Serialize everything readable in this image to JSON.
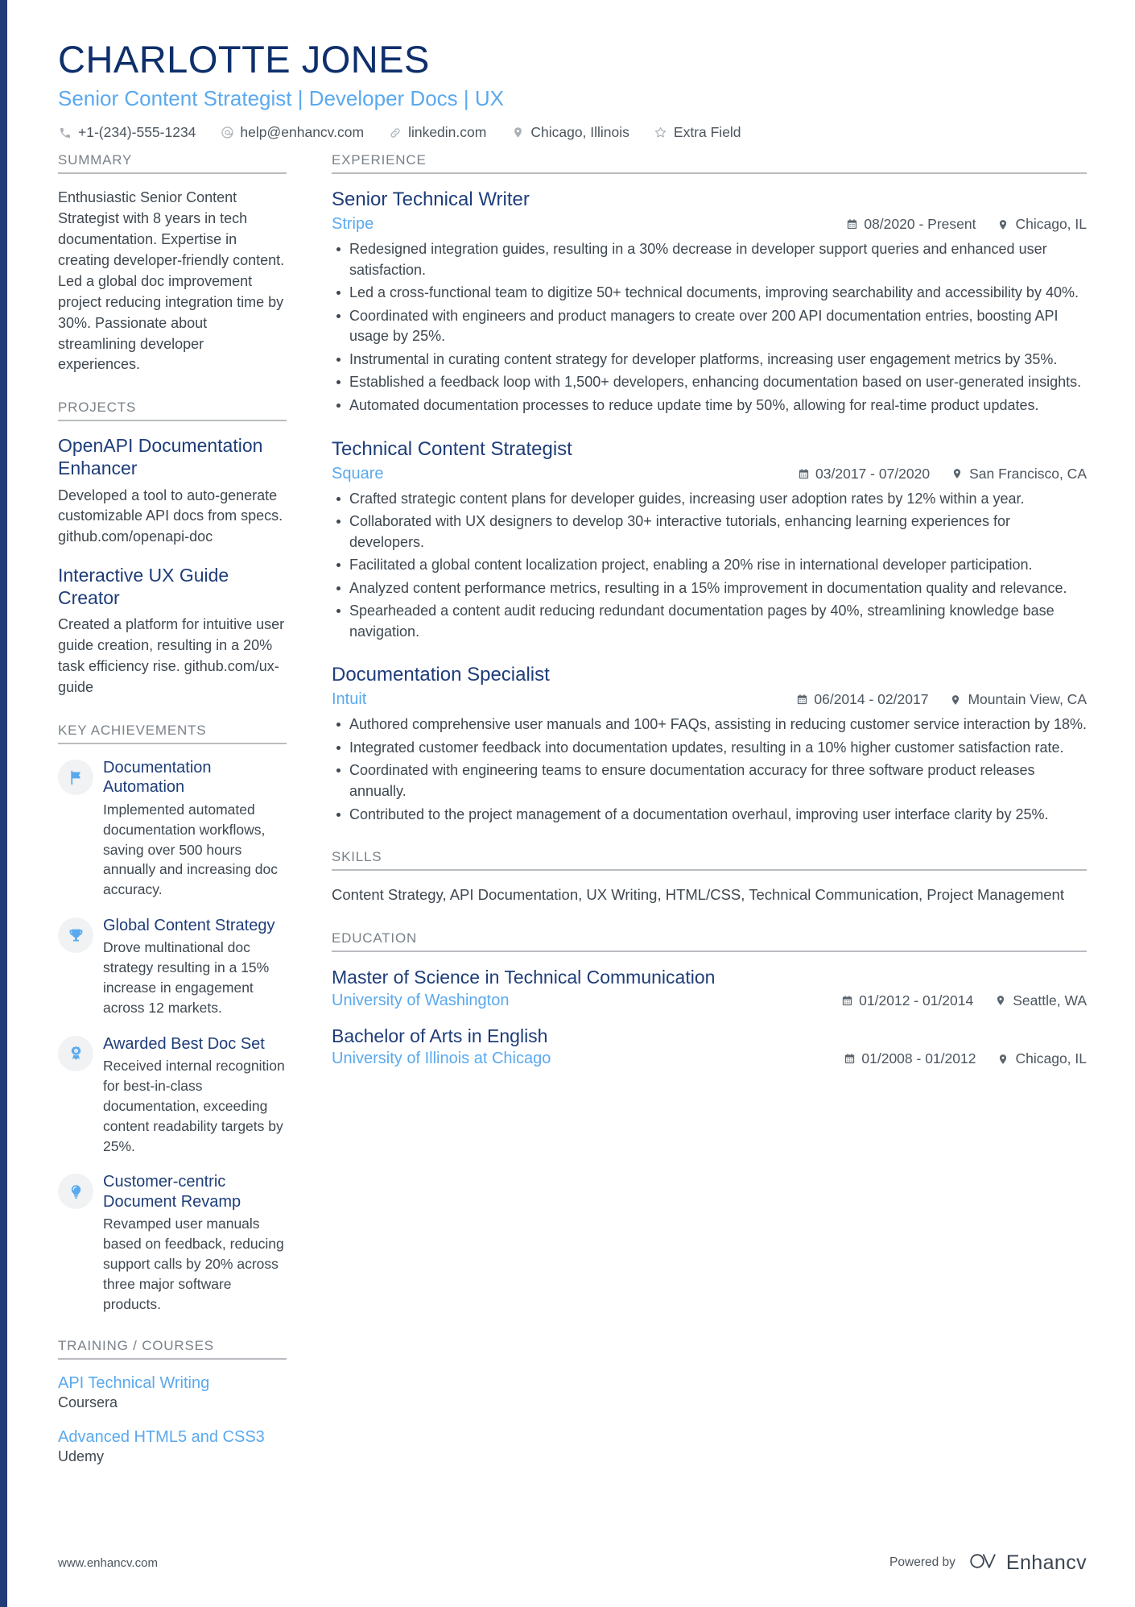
{
  "theme": {
    "navy": "#1e3d79",
    "light_blue": "#5aa9ee",
    "body_text": "#3f4850",
    "muted": "#7a8289",
    "rule": "#b9bcbf"
  },
  "header": {
    "name": "CHARLOTTE JONES",
    "headline": "Senior Content Strategist | Developer Docs | UX",
    "contacts": [
      {
        "icon": "phone-icon",
        "text": "+1-(234)-555-1234"
      },
      {
        "icon": "email-icon",
        "text": "help@enhancv.com"
      },
      {
        "icon": "link-icon",
        "text": "linkedin.com"
      },
      {
        "icon": "location-pin-icon",
        "text": "Chicago, Illinois"
      },
      {
        "icon": "star-icon",
        "text": "Extra Field"
      }
    ]
  },
  "sidebar": {
    "summary": {
      "heading": "SUMMARY",
      "text": "Enthusiastic Senior Content Strategist with 8 years in tech documentation. Expertise in creating developer-friendly content. Led a global doc improvement project reducing integration time by 30%. Passionate about streamlining developer experiences."
    },
    "projects": {
      "heading": "PROJECTS",
      "items": [
        {
          "title": "OpenAPI Documentation Enhancer",
          "description": "Developed a tool to auto-generate customizable API docs from specs. github.com/openapi-doc"
        },
        {
          "title": "Interactive UX Guide Creator",
          "description": "Created a platform for intuitive user guide creation, resulting in a 20% task efficiency rise. github.com/ux-guide"
        }
      ]
    },
    "achievements": {
      "heading": "KEY ACHIEVEMENTS",
      "items": [
        {
          "icon": "flag-icon",
          "title": "Documentation Automation",
          "description": "Implemented automated documentation workflows, saving over 500 hours annually and increasing doc accuracy."
        },
        {
          "icon": "trophy-icon",
          "title": "Global Content Strategy",
          "description": "Drove multinational doc strategy resulting in a 15% increase in engagement across 12 markets."
        },
        {
          "icon": "award-ribbon-icon",
          "title": "Awarded Best Doc Set",
          "description": "Received internal recognition for best-in-class documentation, exceeding content readability targets by 25%."
        },
        {
          "icon": "lightbulb-icon",
          "title": "Customer-centric Document Revamp",
          "description": "Revamped user manuals based on feedback, reducing support calls by 20% across three major software products."
        }
      ]
    },
    "training": {
      "heading": "TRAINING / COURSES",
      "items": [
        {
          "title": "API Technical Writing",
          "org": "Coursera"
        },
        {
          "title": "Advanced HTML5 and CSS3",
          "org": "Udemy"
        }
      ]
    }
  },
  "main": {
    "experience": {
      "heading": "EXPERIENCE",
      "jobs": [
        {
          "title": "Senior Technical Writer",
          "company": "Stripe",
          "dates": "08/2020 - Present",
          "location": "Chicago, IL",
          "bullets": [
            "Redesigned integration guides, resulting in a 30% decrease in developer support queries and enhanced user satisfaction.",
            "Led a cross-functional team to digitize 50+ technical documents, improving searchability and accessibility by 40%.",
            "Coordinated with engineers and product managers to create over 200 API documentation entries, boosting API usage by 25%.",
            "Instrumental in curating content strategy for developer platforms, increasing user engagement metrics by 35%.",
            "Established a feedback loop with 1,500+ developers, enhancing documentation based on user-generated insights.",
            "Automated documentation processes to reduce update time by 50%, allowing for real-time product updates."
          ]
        },
        {
          "title": "Technical Content Strategist",
          "company": "Square",
          "dates": "03/2017 - 07/2020",
          "location": "San Francisco, CA",
          "bullets": [
            "Crafted strategic content plans for developer guides, increasing user adoption rates by 12% within a year.",
            "Collaborated with UX designers to develop 30+ interactive tutorials, enhancing learning experiences for developers.",
            "Facilitated a global content localization project, enabling a 20% rise in international developer participation.",
            "Analyzed content performance metrics, resulting in a 15% improvement in documentation quality and relevance.",
            "Spearheaded a content audit reducing redundant documentation pages by 40%, streamlining knowledge base navigation."
          ]
        },
        {
          "title": "Documentation Specialist",
          "company": "Intuit",
          "dates": "06/2014 - 02/2017",
          "location": "Mountain View, CA",
          "bullets": [
            "Authored comprehensive user manuals and 100+ FAQs, assisting in reducing customer service interaction by 18%.",
            "Integrated customer feedback into documentation updates, resulting in a 10% higher customer satisfaction rate.",
            "Coordinated with engineering teams to ensure documentation accuracy for three software product releases annually.",
            "Contributed to the project management of a documentation overhaul, improving user interface clarity by 25%."
          ]
        }
      ]
    },
    "skills": {
      "heading": "SKILLS",
      "text": "Content Strategy, API Documentation, UX Writing, HTML/CSS, Technical Communication, Project Management"
    },
    "education": {
      "heading": "EDUCATION",
      "items": [
        {
          "degree": "Master of Science in Technical Communication",
          "school": "University of Washington",
          "dates": "01/2012 - 01/2014",
          "location": "Seattle, WA"
        },
        {
          "degree": "Bachelor of Arts in English",
          "school": "University of Illinois at Chicago",
          "dates": "01/2008 - 01/2012",
          "location": "Chicago, IL"
        }
      ]
    }
  },
  "footer": {
    "url": "www.enhancv.com",
    "powered_by": "Powered by",
    "brand": "Enhancv"
  }
}
